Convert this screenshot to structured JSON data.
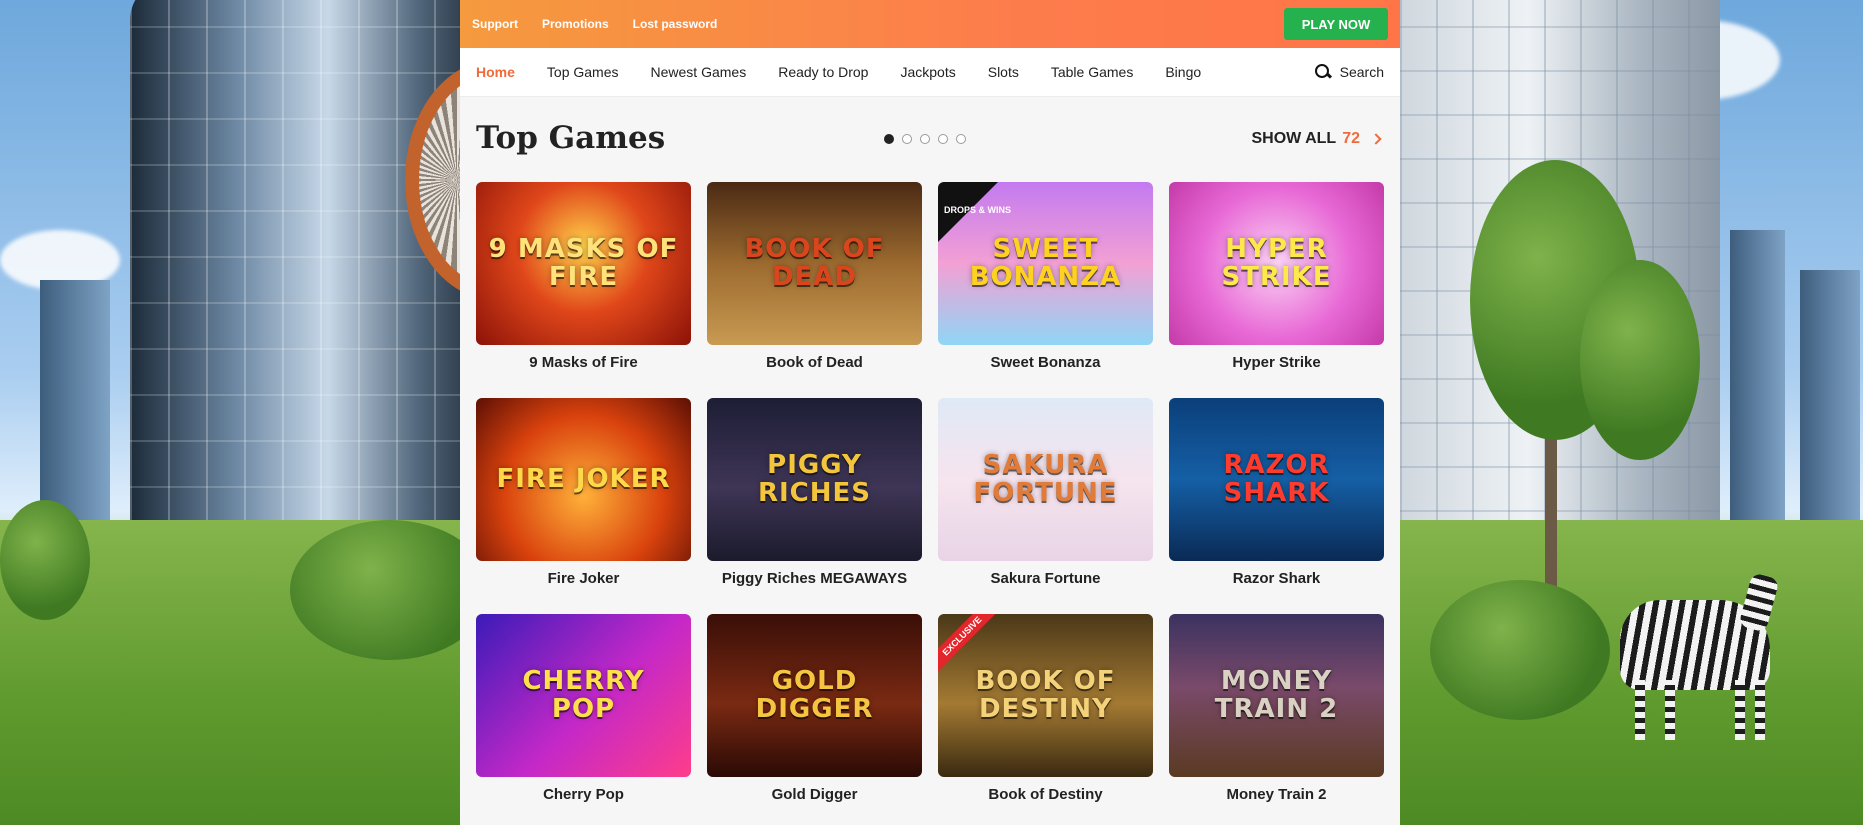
{
  "topbar": {
    "links": [
      "Support",
      "Promotions",
      "Lost password"
    ],
    "play_now": "PLAY NOW"
  },
  "nav": {
    "items": [
      {
        "label": "Home",
        "active": true
      },
      {
        "label": "Top Games"
      },
      {
        "label": "Newest Games"
      },
      {
        "label": "Ready to Drop"
      },
      {
        "label": "Jackpots"
      },
      {
        "label": "Slots"
      },
      {
        "label": "Table Games"
      },
      {
        "label": "Bingo"
      }
    ],
    "search_label": "Search"
  },
  "section": {
    "title": "Top Games",
    "show_all_label": "SHOW ALL",
    "show_all_count": "72",
    "pages": 5,
    "active_page": 1
  },
  "games": [
    {
      "title": "9 Masks of Fire",
      "art": "9 MASKS OF FIRE",
      "bg": "radial-gradient(circle at 50% 40%, #ffd24a, #e0471a 45%, #8b1208 100%)",
      "fg": "#ffe27a"
    },
    {
      "title": "Book of Dead",
      "art": "BOOK OF DEAD",
      "bg": "linear-gradient(#4a2a14, #9c6a2f 50%, #c89a52)",
      "fg": "#d9461d"
    },
    {
      "title": "Sweet Bonanza",
      "art": "SWEET BONANZA",
      "bg": "linear-gradient(#c37af0, #f3a0d4 50%, #8fd6f5)",
      "fg": "#ffd21f",
      "badge": "DROPS & WINS"
    },
    {
      "title": "Hyper Strike",
      "art": "HYPER STRIKE",
      "bg": "radial-gradient(circle, #fbd2f4, #e86ad6 55%, #c43aa9)",
      "fg": "#ffe84a"
    },
    {
      "title": "Fire Joker",
      "art": "FIRE JOKER",
      "bg": "radial-gradient(circle at 50% 60%, #ffb13a, #d9420d 55%, #5c0f05)",
      "fg": "#ffd84a"
    },
    {
      "title": "Piggy Riches MEGAWAYS",
      "art": "PIGGY RICHES",
      "bg": "linear-gradient(#1d1e35, #3f3556 55%, #1b1b2c)",
      "fg": "#f2c53d"
    },
    {
      "title": "Sakura Fortune",
      "art": "SAKURA FORTUNE",
      "bg": "linear-gradient(#dfe9f6, #f6e4ee 50%, #e8d4e6)",
      "fg": "#e07b3a"
    },
    {
      "title": "Razor Shark",
      "art": "RAZOR SHARK",
      "bg": "linear-gradient(#0b3f7a, #155fa5 50%, #0a2a55)",
      "fg": "#ff3b2e"
    },
    {
      "title": "Cherry Pop",
      "art": "CHERRY POP",
      "bg": "linear-gradient(135deg, #3b1bb8, #c428c8 55%, #ff3d8a)",
      "fg": "#ffe04a"
    },
    {
      "title": "Gold Digger",
      "art": "GOLD DIGGER",
      "bg": "linear-gradient(#3a0e08, #7a2a12 55%, #2a0a05)",
      "fg": "#f5c542"
    },
    {
      "title": "Book of Destiny",
      "art": "BOOK OF DESTINY",
      "bg": "linear-gradient(#4a3818, #a47a33 55%, #3a2a10)",
      "fg": "#f3d27a",
      "ribbon": "EXCLUSIVE"
    },
    {
      "title": "Money Train 2",
      "art": "MONEY TRAIN 2",
      "bg": "linear-gradient(#3b3260, #7a4a6a 45%, #5a3a22)",
      "fg": "#d9d2c3"
    }
  ]
}
